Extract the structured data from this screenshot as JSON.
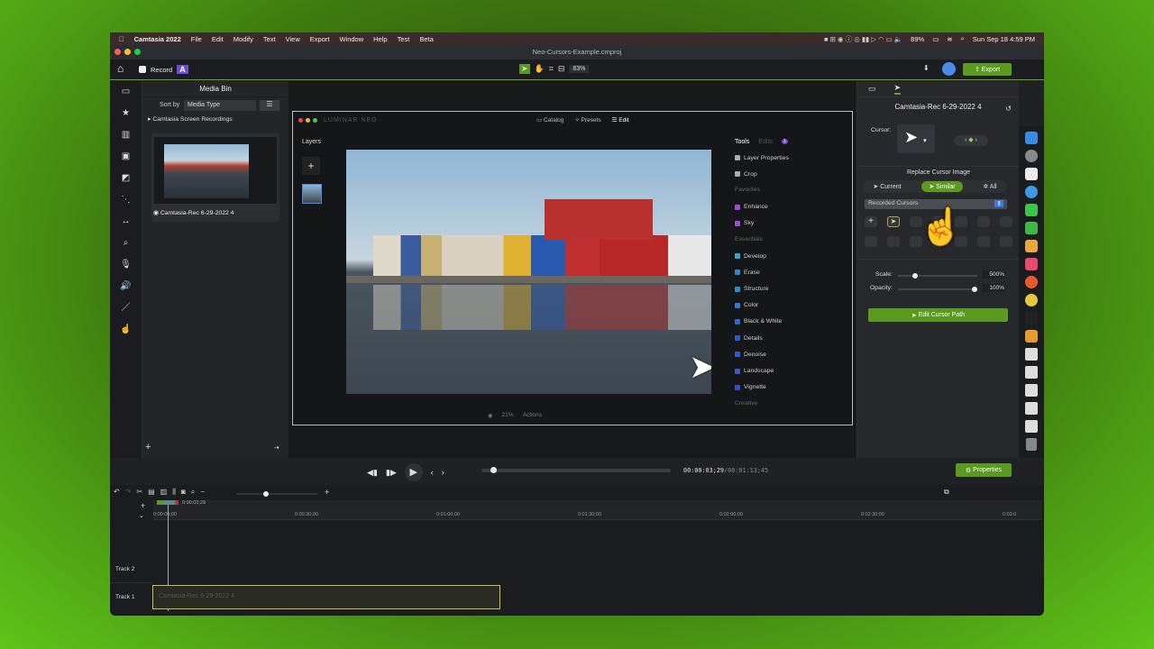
{
  "menubar": {
    "app": "Camtasia 2022",
    "items": [
      "File",
      "Edit",
      "Modify",
      "Text",
      "View",
      "Export",
      "Window",
      "Help",
      "Test",
      "Beta"
    ],
    "battery": "89%",
    "datetime": "Sun Sep 18  4:59 PM"
  },
  "window": {
    "title": "Neo-Cursors-Example.cmproj"
  },
  "toolbar": {
    "record": "Record",
    "zoom": "83%",
    "export": "Export"
  },
  "media_bin": {
    "title": "Media Bin",
    "sort_label": "Sort by",
    "sort_value": "Media Type",
    "group": "Camtasia Screen Recordings",
    "clip": "Camtasia-Rec 6-29-2022 4"
  },
  "luminar": {
    "logo": "LUMINAR NEO",
    "tabs": [
      "Catalog",
      "Presets",
      "Edit"
    ],
    "layers": "Layers",
    "tools_tab": "Tools",
    "edits_tab": "Edits",
    "edits_badge": "1",
    "tools": [
      {
        "label": "Layer Properties",
        "color": "#aaa"
      },
      {
        "label": "Crop",
        "color": "#aaa"
      }
    ],
    "favorites_label": "Favorites",
    "favorites": [
      {
        "label": "Enhance",
        "color": "#a04ad8"
      },
      {
        "label": "Sky",
        "color": "#a04ad8"
      }
    ],
    "essentials_label": "Essentials",
    "essentials": [
      {
        "label": "Develop",
        "color": "#2aa8d8"
      },
      {
        "label": "Erase",
        "color": "#2a8ad8"
      },
      {
        "label": "Structure",
        "color": "#2a8ad8"
      },
      {
        "label": "Color",
        "color": "#2a7ad8"
      },
      {
        "label": "Black & White",
        "color": "#2a6ad8"
      },
      {
        "label": "Details",
        "color": "#2a5ad0"
      },
      {
        "label": "Denoise",
        "color": "#2a5ad0"
      },
      {
        "label": "Landscape",
        "color": "#3a5ad0"
      },
      {
        "label": "Vignette",
        "color": "#3a4ad0"
      }
    ],
    "creative_label": "Creative",
    "zoom": "21%",
    "actions": "Actions"
  },
  "properties": {
    "clip_title": "Camtasia-Rec 6-29-2022 4",
    "cursor_label": "Cursor:",
    "replace_title": "Replace Cursor Image",
    "options": [
      "Current",
      "Similar",
      "All"
    ],
    "selected_option": "Similar",
    "library": "Recorded Cursors",
    "scale_label": "Scale:",
    "scale_value": "500%",
    "scale_fraction": 0.2,
    "opacity_label": "Opacity:",
    "opacity_value": "100%",
    "opacity_fraction": 1.0,
    "edit_path": "Edit Cursor Path"
  },
  "transport": {
    "current": "00:00:03;29",
    "total": "/00:01:13;45",
    "properties": "Properties",
    "progress": 0.05
  },
  "timeline": {
    "playhead": "0:00:03;29",
    "ticks": [
      "0:00:00;00",
      "0:00:30;00",
      "0:01:00;00",
      "0:01:30;00",
      "0:02:00;00",
      "0:02:30;00",
      "0:03:0"
    ],
    "tracks": [
      "Track 2",
      "Track 1"
    ],
    "clip": "Camtasia-Rec 6-29-2022 4"
  }
}
